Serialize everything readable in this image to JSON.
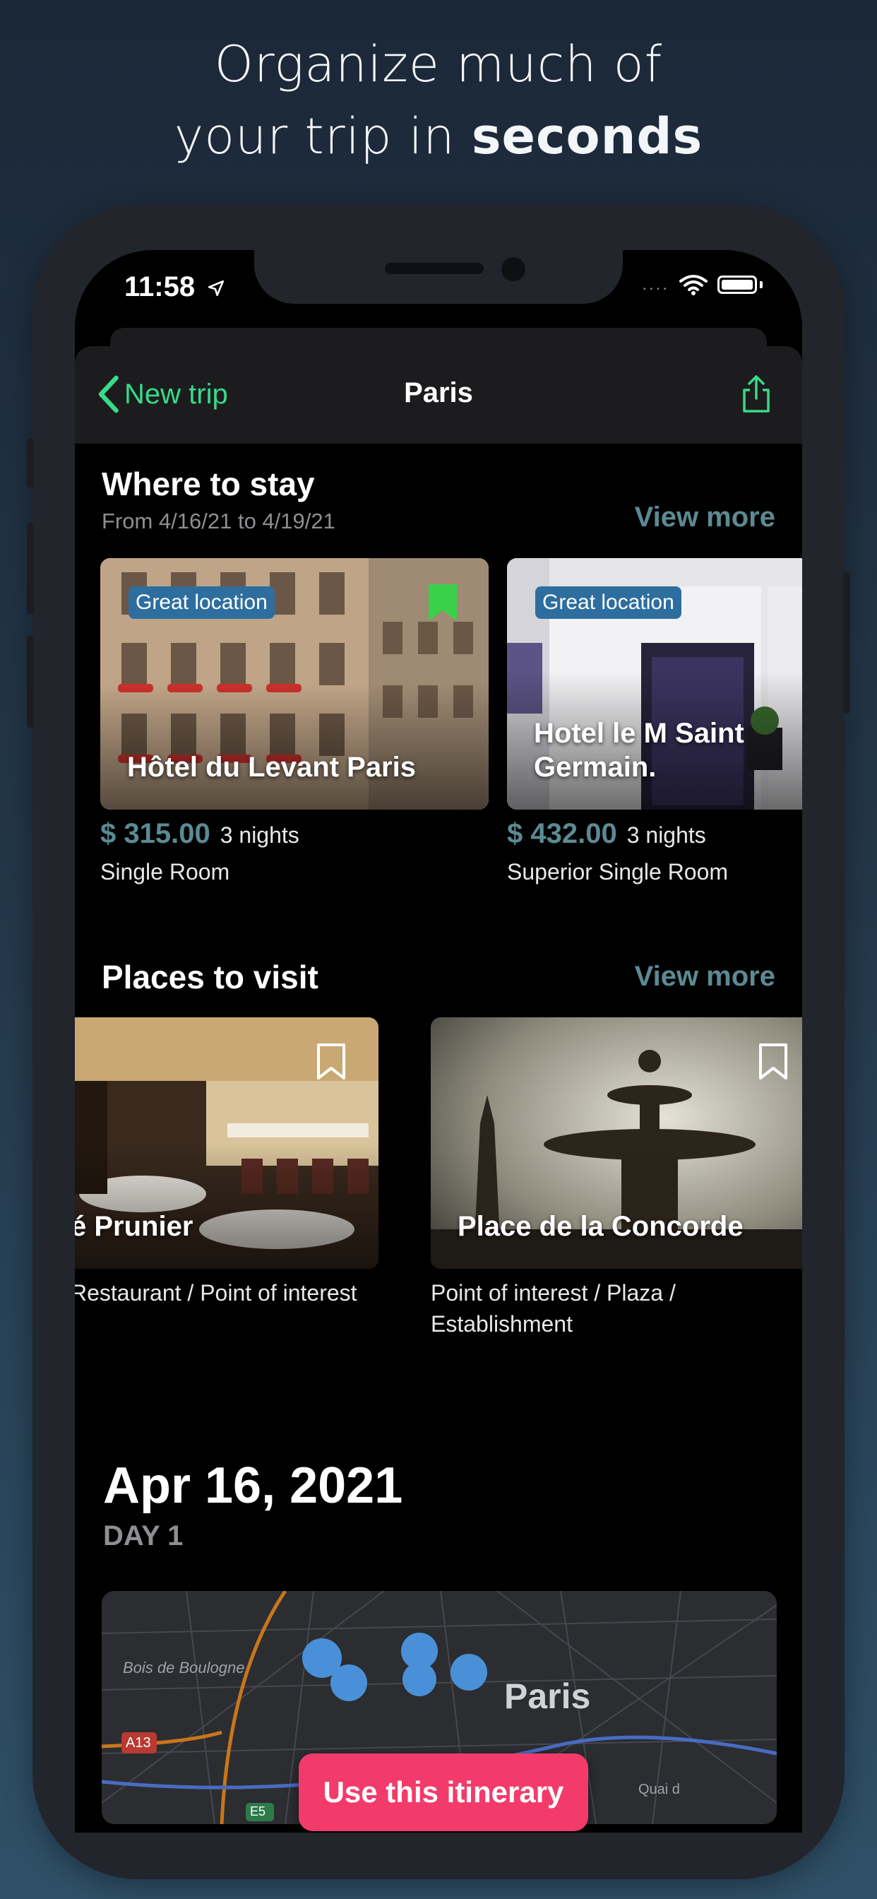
{
  "headline": {
    "line1": "Organize much of",
    "line2_prefix": "your trip in ",
    "line2_bold": "seconds"
  },
  "status": {
    "time": "11:58",
    "signal": "....",
    "location_icon": "location-arrow-icon",
    "wifi_icon": "wifi-icon",
    "battery_icon": "battery-icon"
  },
  "nav": {
    "back_label": "New trip",
    "title": "Paris",
    "share_icon": "share-icon"
  },
  "stay": {
    "title": "Where to stay",
    "dates": "From 4/16/21 to 4/19/21",
    "view_more": "View more",
    "hotels": [
      {
        "badge": "Great location",
        "name": "Hôtel du Levant Paris",
        "price": "$ 315.00",
        "nights": "3 nights",
        "room": "Single Room",
        "bookmarked": true
      },
      {
        "badge": "Great location",
        "name": "Hotel le M Saint Germain.",
        "price": "$ 432.00",
        "nights": "3 nights",
        "room": "Superior Single Room",
        "bookmarked": false
      }
    ]
  },
  "places": {
    "title": "Places to visit",
    "view_more": "View more",
    "items": [
      {
        "name": "é Prunier",
        "category": "Restaurant / Point of interest"
      },
      {
        "name": "Place de la Concorde",
        "category": "Point of interest / Plaza / Establishment"
      }
    ]
  },
  "day": {
    "date": "Apr 16, 2021",
    "label": "DAY 1"
  },
  "map": {
    "labels": [
      "Bois de Boulogne",
      "Paris",
      "A13",
      "E5",
      "Quai d"
    ],
    "pin_color": "#3aa84a",
    "museum_color": "#4a90d9"
  },
  "cta": {
    "label": "Use this itinerary"
  },
  "colors": {
    "accent": "#39d98a",
    "price": "#5b8a94",
    "cta": "#f23b6b"
  }
}
